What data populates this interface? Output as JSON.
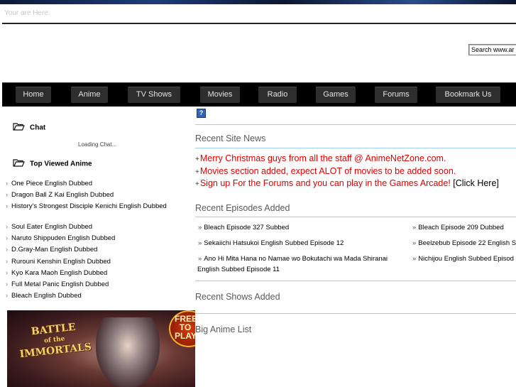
{
  "breadcrumb": "Your are Here:",
  "search": {
    "value": "Search www.ar"
  },
  "nav": [
    "Home",
    "Anime",
    "TV Shows",
    "Movies",
    "Radio",
    "Games",
    "Forums",
    "Bookmark Us"
  ],
  "sidebar": {
    "chat_heading": "Chat",
    "loading_text": "Loading Chat...",
    "top_heading": "Top Viewed Anime",
    "group1": [
      "One Piece English Dubbed",
      "Dragon Ball Z Kai English Dubbed",
      "History's Strongest Disciple Kenichi English Dubbed"
    ],
    "group2": [
      "Soul Eater English Dubbed",
      "Naruto Shippuden English Dubbed",
      "D.Gray-Man English Dubbed",
      "Rurouni Kenshin English Dubbed",
      "Kyo Kara Maoh English Dubbed",
      "Full Metal Panic English Dubbed",
      "Bleach English Dubbed"
    ]
  },
  "ad": {
    "logo_line1": "BATTLE",
    "logo_line2": "of the",
    "logo_line3": "IMMORTALS",
    "badge": "FREE TO PLAY"
  },
  "main": {
    "help_icon": "?",
    "site_news_title": "Recent Site News",
    "news": [
      "Merry Christmas guys from all the staff @ AnimeNetZone.com.",
      "Movies section added, expect ALOT of movies to be added soon.",
      "Sign up For the Forums and you can play in the Games Arcade!"
    ],
    "click_here": "[Click Here]",
    "episodes_title": "Recent Episodes Added",
    "episodes_left": [
      "Bleach Episode 327 Subbed",
      "Sekaiichi Hatsukoi English Subbed Episode 12",
      "Ano Hi Mita Hana no Namae wo Bokutachi wa Mada Shiranai",
      "English Subbed Episode 11"
    ],
    "episodes_right": [
      "Bleach Episode 209 Dubbed",
      "Beelzebub Episode 22 English S",
      "Nichijou English Subbed Episod"
    ],
    "shows_title": "Recent Shows Added",
    "big_list_title": "Big Anime List"
  },
  "colors": {
    "news_red": "#e00000",
    "rule_blue": "#9cd0ee",
    "nav_bg": "#000000",
    "nav_button": "#2e2e2e"
  }
}
